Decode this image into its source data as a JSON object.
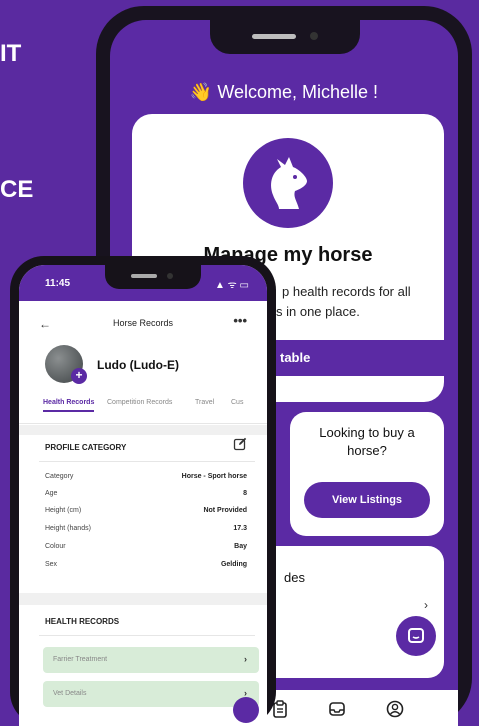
{
  "background": {
    "text_top": "IT",
    "text_mid": "CE",
    "color": "#5a2aa0"
  },
  "home_screen": {
    "welcome": "👋 Welcome, Michelle !",
    "manage_card": {
      "icon": "horse-head-icon",
      "title": "Manage my horse",
      "description_line1": "p health records for all",
      "description_line2": "s in one place.",
      "button": "table"
    },
    "buy_card": {
      "title_line1": "Looking to buy a",
      "title_line2": "horse?",
      "button": "View Listings"
    },
    "des_card": {
      "text": "des",
      "chevron": "›"
    },
    "chat_icon": "chat-icon",
    "bottom_nav": [
      "clipboard-icon",
      "inbox-icon",
      "user-circle-icon"
    ]
  },
  "records_screen": {
    "status_time": "11:45",
    "status_icons": "▲ ᯤ ▭",
    "header": {
      "back": "←",
      "title": "Horse Records",
      "more": "•••"
    },
    "horse": {
      "name": "Ludo (Ludo-E)",
      "plus": "+"
    },
    "tabs": [
      {
        "label": "Health Records",
        "active": true
      },
      {
        "label": "Competition Records",
        "active": false
      },
      {
        "label": "Travel",
        "active": false
      },
      {
        "label": "Cus",
        "active": false
      }
    ],
    "profile_category": {
      "header": "PROFILE CATEGORY",
      "rows": [
        {
          "label": "Category",
          "value": "Horse - Sport horse"
        },
        {
          "label": "Age",
          "value": "8"
        },
        {
          "label": "Height (cm)",
          "value": "Not Provided"
        },
        {
          "label": "Height (hands)",
          "value": "17.3"
        },
        {
          "label": "Colour",
          "value": "Bay"
        },
        {
          "label": "Sex",
          "value": "Gelding"
        }
      ]
    },
    "health_records": {
      "header": "HEALTH RECORDS",
      "items": [
        {
          "label": "Farrier Treatment",
          "chevron": "›"
        },
        {
          "label": "Vet Details",
          "chevron": "›"
        }
      ]
    }
  },
  "colors": {
    "accent": "#5b2aa4",
    "record_row": "#d8ecd8"
  }
}
